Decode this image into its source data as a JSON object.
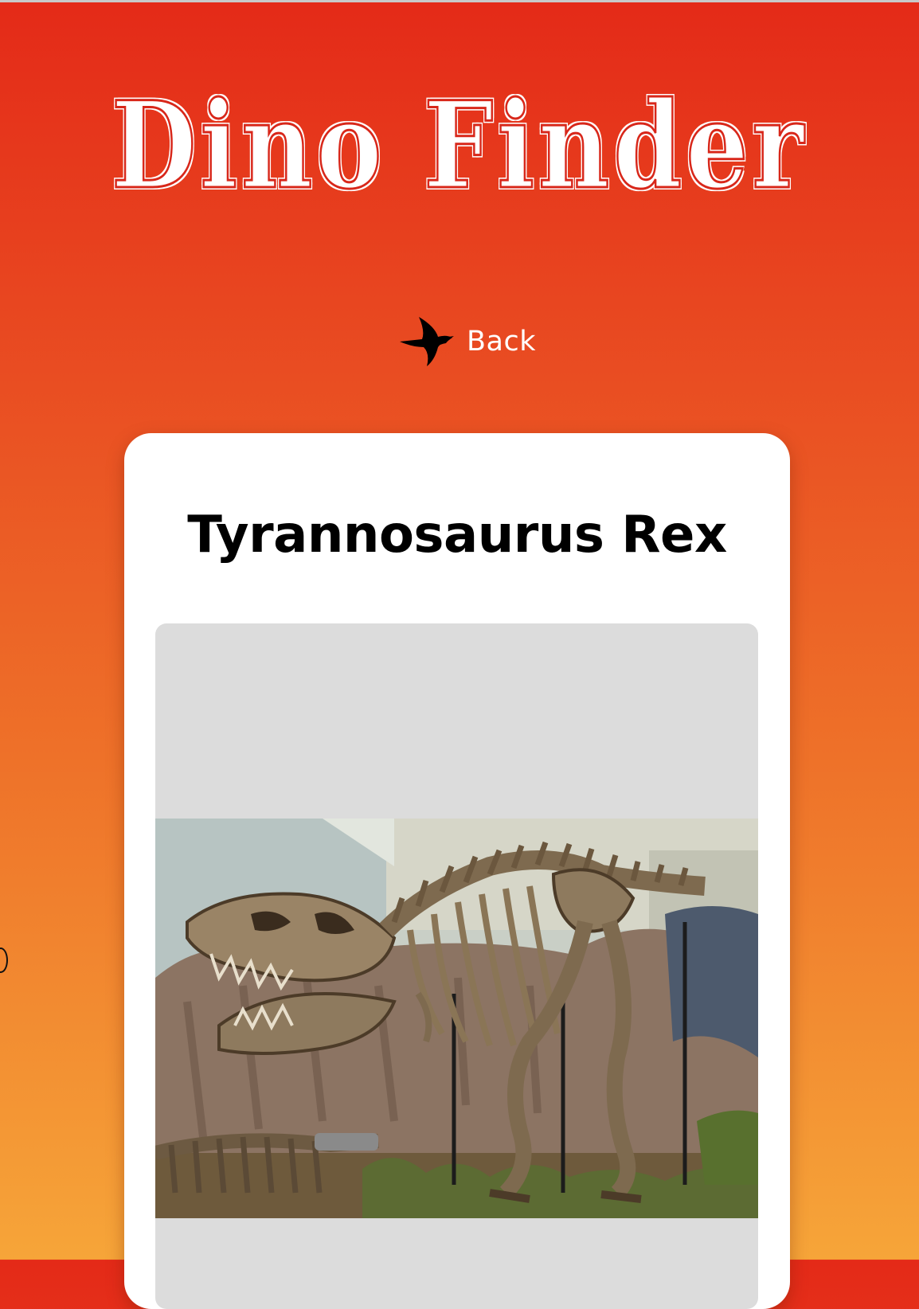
{
  "app": {
    "title": "Dino Finder"
  },
  "nav": {
    "back_label": "Back",
    "back_icon": "pterodactyl-icon"
  },
  "dinosaur": {
    "name": "Tyrannosaurus Rex",
    "image_alt": "Tyrannosaurus Rex skeleton"
  },
  "colors": {
    "gradient_top": "#e42a18",
    "gradient_bottom": "#f6a539",
    "card_background": "#ffffff",
    "image_placeholder": "#dcdcdc"
  }
}
